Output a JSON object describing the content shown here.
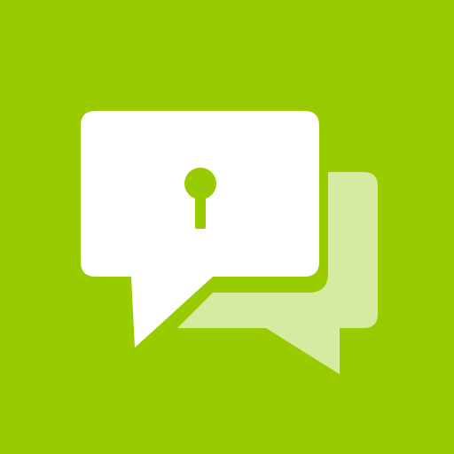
{
  "app_icon": {
    "icon_name": "secure-chat-icon",
    "colors": {
      "background": "#99CC00",
      "front_bubble": "#FFFFFF",
      "back_bubble": "#D6EAA2",
      "keyhole": "#99CC00"
    },
    "parts": [
      "back-chat-bubble-icon",
      "front-chat-bubble-icon",
      "keyhole-icon"
    ]
  }
}
